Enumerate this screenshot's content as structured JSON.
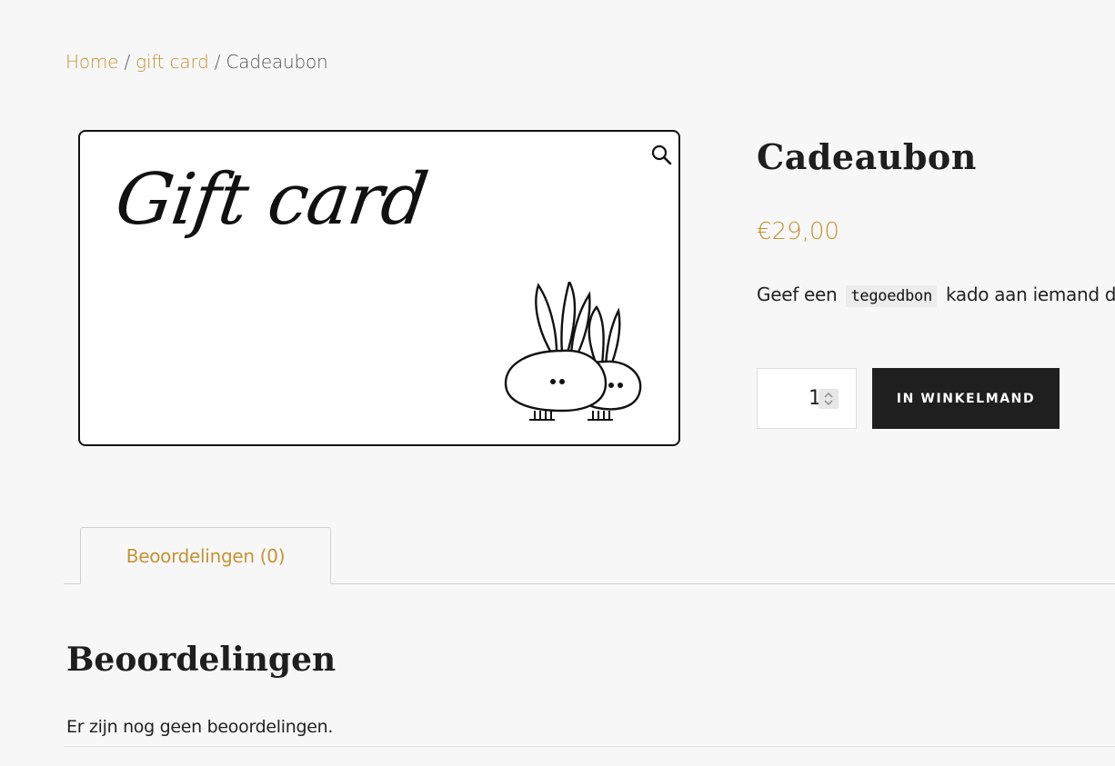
{
  "breadcrumb": {
    "home": "Home",
    "sep1": "/",
    "category": "gift card",
    "sep2": "/",
    "current": "Cadeaubon"
  },
  "gallery": {
    "image_text": "Gift card",
    "zoom_icon": "magnifier-icon"
  },
  "product": {
    "title": "Cadeaubon",
    "price": "€29,00",
    "desc_before": "Geef een",
    "desc_code": "tegoedbon",
    "desc_after": "kado aan iemand d"
  },
  "cart": {
    "quantity": "1",
    "button_label": "IN WINKELMAND"
  },
  "tabs": [
    {
      "label": "Beoordelingen (0)"
    }
  ],
  "reviews": {
    "title": "Beoordelingen",
    "empty_text": "Er zijn nog geen beoordelingen."
  },
  "colors": {
    "accent": "#c39435",
    "button": "#1f1f1f",
    "background": "#f7f7f7"
  }
}
